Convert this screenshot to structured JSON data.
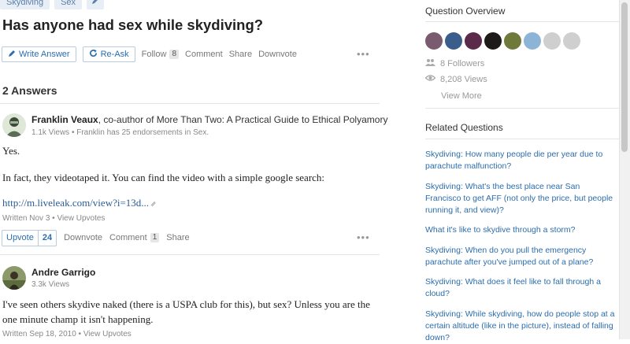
{
  "question": {
    "tags": [
      "Skydiving",
      "Sex"
    ],
    "title": "Has anyone had sex while skydiving?",
    "actions": {
      "write_answer": "Write Answer",
      "re_ask": "Re-Ask",
      "follow": "Follow",
      "follow_count": "8",
      "comment": "Comment",
      "share": "Share",
      "downvote": "Downvote",
      "more": "•••"
    }
  },
  "answers_heading": "2 Answers",
  "answers": [
    {
      "author_name": "Franklin Veaux",
      "author_cred": ", co-author of More Than Two: A Practical Guide to Ethical Polyamory",
      "meta": "1.1k Views • Franklin has 25 endorsements in Sex.",
      "paragraphs": [
        "Yes.",
        "In fact, they videotaped it. You can find the video with a simple google search:"
      ],
      "link": "http://m.liveleak.com/view?i=13d...",
      "written": "Written Nov 3 • View Upvotes",
      "upvote_label": "Upvote",
      "upvote_count": "24",
      "downvote": "Downvote",
      "comment": "Comment",
      "comment_count": "1",
      "share": "Share",
      "more": "•••"
    },
    {
      "author_name": "Andre Garrigo",
      "meta": "3.3k Views",
      "lines": [
        "I've seen others skydive naked (there is a USPA club for this), but sex? Unless you are the",
        "one minute champ it isn't happening."
      ],
      "written": "Written Sep 18, 2010 • View Upvotes"
    }
  ],
  "sidebar": {
    "overview_title": "Question Overview",
    "followers": "8 Followers",
    "views": "8,208 Views",
    "view_more": "View More",
    "related_title": "Related Questions",
    "related": [
      "Skydiving: How many people die per year due to parachute malfunction?",
      "Skydiving: What's the best place near San Francisco to get AFF (not only the price, but people running it, and view)?",
      "What it's like to skydive through a storm?",
      "Skydiving: When do you pull the emergency parachute after you've jumped out of a plane?",
      "Skydiving: What does it feel like to fall through a cloud?",
      "Skydiving: While skydiving, how do people stop at a certain altitude (like in the picture), instead of falling down?"
    ]
  },
  "colors": {
    "link_blue": "#2b6dad",
    "muted": "#999999",
    "rule": "#e5e5e5"
  }
}
